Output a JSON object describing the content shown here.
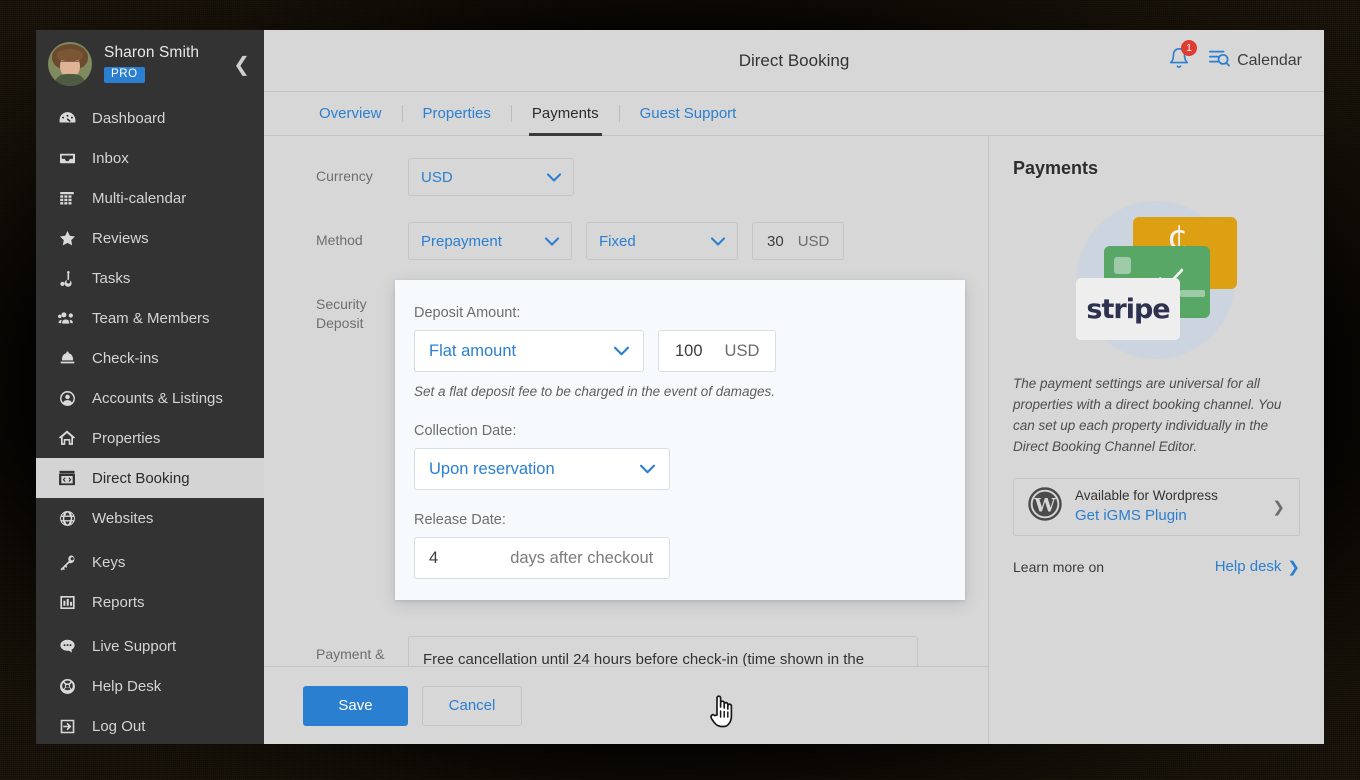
{
  "sidebar": {
    "user": {
      "name": "Sharon Smith",
      "badge": "PRO",
      "avatar_icon": "user-avatar"
    },
    "collapse_icon": "chevron-left-icon",
    "items": [
      {
        "label": "Dashboard",
        "icon": "dashboard-icon",
        "active": false
      },
      {
        "label": "Inbox",
        "icon": "inbox-icon",
        "active": false
      },
      {
        "label": "Multi-calendar",
        "icon": "calendar-icon",
        "active": false
      },
      {
        "label": "Reviews",
        "icon": "star-icon",
        "active": false
      },
      {
        "label": "Tasks",
        "icon": "tasks-icon",
        "active": false
      },
      {
        "label": "Team & Members",
        "icon": "users-icon",
        "active": false
      },
      {
        "label": "Check-ins",
        "icon": "bell-desk-icon",
        "active": false
      },
      {
        "label": "Accounts & Listings",
        "icon": "account-circle-icon",
        "active": false
      },
      {
        "label": "Properties",
        "icon": "home-icon",
        "active": false
      },
      {
        "label": "Direct Booking",
        "icon": "code-window-icon",
        "active": true
      },
      {
        "label": "Websites",
        "icon": "globe-icon",
        "active": false
      },
      {
        "label": "Keys",
        "icon": "key-icon",
        "active": false
      },
      {
        "label": "Reports",
        "icon": "bar-chart-icon",
        "active": false
      },
      {
        "label": "Live Support",
        "icon": "chat-bubble-icon",
        "active": false
      },
      {
        "label": "Help Desk",
        "icon": "lifebuoy-icon",
        "active": false
      },
      {
        "label": "Log Out",
        "icon": "logout-icon",
        "active": false
      }
    ]
  },
  "header": {
    "title": "Direct Booking",
    "notification_icon": "bell-icon",
    "notification_count": "1",
    "calendar_icon": "calendar-search-icon",
    "calendar_label": "Calendar"
  },
  "tabs": [
    {
      "label": "Overview",
      "active": false
    },
    {
      "label": "Properties",
      "active": false
    },
    {
      "label": "Payments",
      "active": true
    },
    {
      "label": "Guest Support",
      "active": false
    }
  ],
  "form": {
    "currency": {
      "label": "Currency",
      "value": "USD"
    },
    "method": {
      "label": "Method",
      "type_value": "Prepayment",
      "mode_value": "Fixed",
      "amount": "30",
      "currency": "USD"
    },
    "security_deposit": {
      "label": "Security Deposit"
    },
    "payment_cancellation": {
      "label": "Payment & cancellation",
      "value": "Free cancellation until 24 hours before check-in (time shown in the"
    }
  },
  "deposit_card": {
    "amount_label": "Deposit Amount:",
    "amount_type": "Flat amount",
    "amount_value": "100",
    "amount_currency": "USD",
    "hint": "Set a flat deposit fee to be charged in the event of damages.",
    "collection_label": "Collection Date:",
    "collection_value": "Upon reservation",
    "release_label": "Release Date:",
    "release_value": "4",
    "release_suffix": "days after checkout"
  },
  "actions": {
    "save": "Save",
    "cancel": "Cancel"
  },
  "info_panel": {
    "title": "Payments",
    "stripe_logo": "stripe",
    "description": "The payment settings are universal for all properties with a direct booking channel. You can set up each property individually in the Direct Booking Channel Editor.",
    "wordpress": {
      "icon": "wordpress-icon",
      "line1": "Available for Wordpress",
      "line2": "Get iGMS Plugin",
      "chevron": "chevron-right-icon"
    },
    "learn_more": "Learn more on",
    "help_desk": "Help desk",
    "help_desk_chevron": "chevron-right-icon"
  },
  "cursor": {
    "icon": "pointer-hand-cursor"
  },
  "colors": {
    "accent_blue": "#2b7fd0",
    "sidebar_bg": "#333333",
    "app_bg": "#d7d7d7",
    "card_bg": "#f7fafd",
    "badge_red": "#e03b2f",
    "stripe_navy": "#2e3150"
  }
}
